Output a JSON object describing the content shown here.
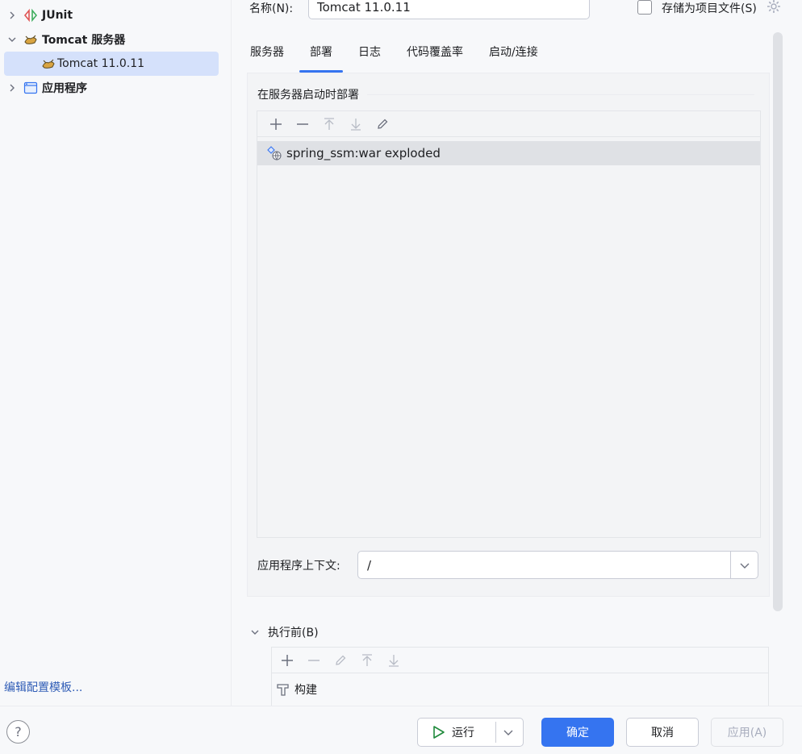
{
  "tree": {
    "items": [
      {
        "label": "JUnit",
        "icon": "junit-icon"
      },
      {
        "label": "Tomcat 服务器",
        "icon": "tomcat-icon"
      },
      {
        "label": "Tomcat 11.0.11",
        "icon": "tomcat-icon"
      },
      {
        "label": "应用程序",
        "icon": "application-icon"
      }
    ]
  },
  "edit_templates_link": "编辑配置模板...",
  "header": {
    "name_label": "名称(N):",
    "name_value": "Tomcat 11.0.11",
    "store_label": "存储为项目文件(S)"
  },
  "tabs": [
    {
      "label": "服务器"
    },
    {
      "label": "部署"
    },
    {
      "label": "日志"
    },
    {
      "label": "代码覆盖率"
    },
    {
      "label": "启动/连接"
    }
  ],
  "deploy": {
    "section_title": "在服务器启动时部署",
    "artifacts": [
      {
        "label": "spring_ssm:war exploded",
        "icon": "artifact-web-icon"
      }
    ],
    "context_label": "应用程序上下文:",
    "context_value": "/"
  },
  "before_launch": {
    "label": "执行前(B)",
    "tasks": [
      {
        "label": "构建",
        "icon": "build-hammer-icon"
      }
    ]
  },
  "buttons": {
    "help": "?",
    "run": "运行",
    "ok": "确定",
    "cancel": "取消",
    "apply": "应用(A)"
  },
  "colors": {
    "accent": "#3574f0",
    "selection": "#d5e1fb",
    "link": "#2f5cb6",
    "run_green": "#208a3c"
  }
}
